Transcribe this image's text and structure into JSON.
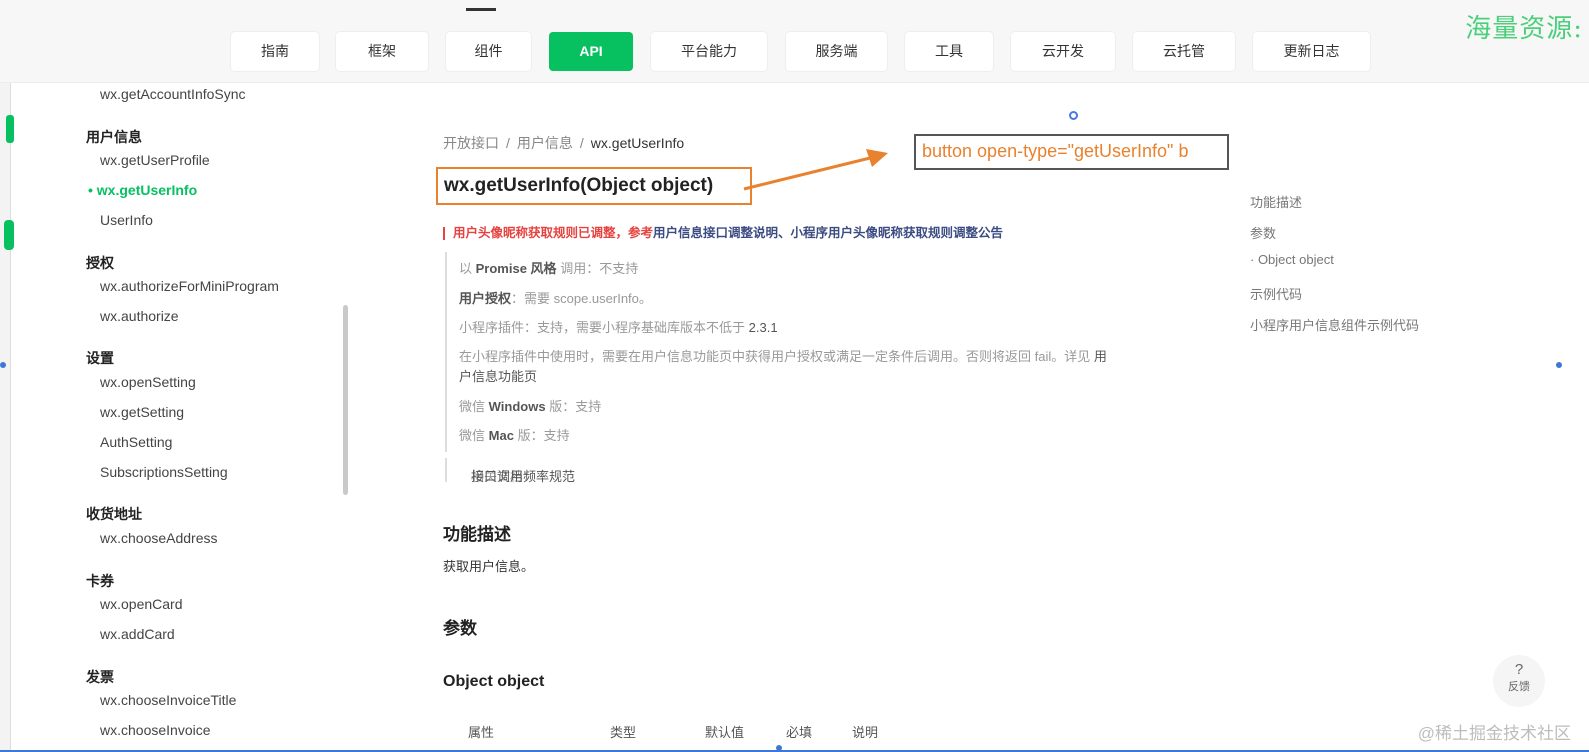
{
  "watermark_top": "海量资源:",
  "watermark_bottom": "@稀土掘金技术社区",
  "nav": [
    "指南",
    "框架",
    "组件",
    "API",
    "平台能力",
    "服务端",
    "工具",
    "云开发",
    "云托管",
    "更新日志"
  ],
  "nav_active": "API",
  "sidebar": {
    "top_item": "wx.getAccountInfoSync",
    "groups": [
      {
        "title": "用户信息",
        "items": [
          "wx.getUserProfile",
          "wx.getUserInfo",
          "UserInfo"
        ]
      },
      {
        "title": "授权",
        "items": [
          "wx.authorizeForMiniProgram",
          "wx.authorize"
        ]
      },
      {
        "title": "设置",
        "items": [
          "wx.openSetting",
          "wx.getSetting",
          "AuthSetting",
          "SubscriptionsSetting"
        ]
      },
      {
        "title": "收货地址",
        "items": [
          "wx.chooseAddress"
        ]
      },
      {
        "title": "卡券",
        "items": [
          "wx.openCard",
          "wx.addCard"
        ]
      },
      {
        "title": "发票",
        "items": [
          "wx.chooseInvoiceTitle",
          "wx.chooseInvoice"
        ]
      }
    ],
    "active_item": "wx.getUserInfo"
  },
  "breadcrumb": [
    "开放接口",
    "用户信息",
    "wx.getUserInfo"
  ],
  "title": "wx.getUserInfo(Object object)",
  "callout_text": "button open-type=\"getUserInfo\" b",
  "notice": {
    "red": "用户头像昵称获取规则已调整，参考",
    "blue": "用户信息接口调整说明、小程序用户头像昵称获取规则调整公告"
  },
  "info": {
    "promise_pre": "以",
    "promise_bold": "Promise 风格",
    "promise_post": "调用：不支持",
    "auth_label": "用户授权",
    "auth_value": "：需要 scope.userInfo。",
    "plugin_label": "小程序插件",
    "plugin_value": "：支持，需要小程序基础库版本不低于",
    "plugin_version": "2.3.1",
    "plugin_note1": "在小程序插件中使用时，需要在用户信息功能页中获得用户授权或满足一定条件后调用。否则将返回 fail。详见",
    "plugin_link1": "用",
    "plugin_link2": "户信息功能页",
    "windows_pre": "微信",
    "windows_bold": "Windows",
    "windows_post": "版：支持",
    "mac_pre": "微信",
    "mac_bold": "Mac",
    "mac_post": "版：支持",
    "related_label": "相关文档：",
    "related_link": "接口调用频率规范"
  },
  "sections": {
    "desc_title": "功能描述",
    "desc_text": "获取用户信息。",
    "params_title": "参数",
    "object_title": "Object object"
  },
  "table_headers": [
    "属性",
    "类型",
    "默认值",
    "必填",
    "说明"
  ],
  "toc": [
    "功能描述",
    "参数",
    "· Object object",
    "示例代码",
    "小程序用户信息组件示例代码"
  ],
  "feedback": {
    "icon": "?",
    "label": "反馈"
  },
  "colors": {
    "accent": "#07c160",
    "callout": "#e9822e",
    "notice_red": "#e64340"
  }
}
